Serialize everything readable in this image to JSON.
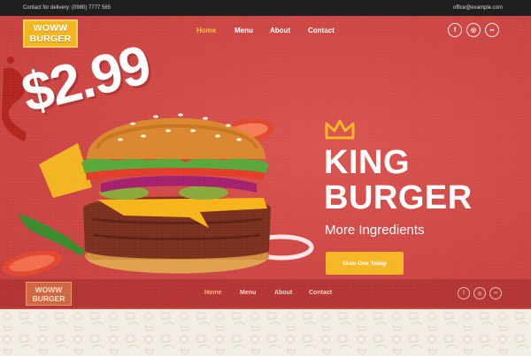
{
  "topbar": {
    "contact": "Contact for delivery: (0980) 7777 565",
    "email": "office@example.com"
  },
  "logo": {
    "line1": "WOWW",
    "line2": "BURGER"
  },
  "nav": {
    "items": [
      "Home",
      "Menu",
      "About",
      "Contact"
    ],
    "active": "Home"
  },
  "social": {
    "icons": [
      "facebook-icon",
      "instagram-icon",
      "tripadvisor-icon"
    ],
    "glyphs": [
      "f",
      "◎",
      "∞"
    ]
  },
  "hero": {
    "price": "$2.99",
    "title_line1": "KING",
    "title_line2": "BURGER",
    "subtitle": "More Ingredients",
    "cta": "Grab One Today"
  },
  "sticky_nav": {
    "logo_line1": "WOWW",
    "logo_line2": "BURGER",
    "items": [
      "Home",
      "Menu",
      "About",
      "Contact"
    ]
  },
  "colors": {
    "hero_red": "#cf4845",
    "accent_yellow": "#f5b623",
    "topbar": "#1f1f1f",
    "pattern_bg": "#f3eee5"
  }
}
